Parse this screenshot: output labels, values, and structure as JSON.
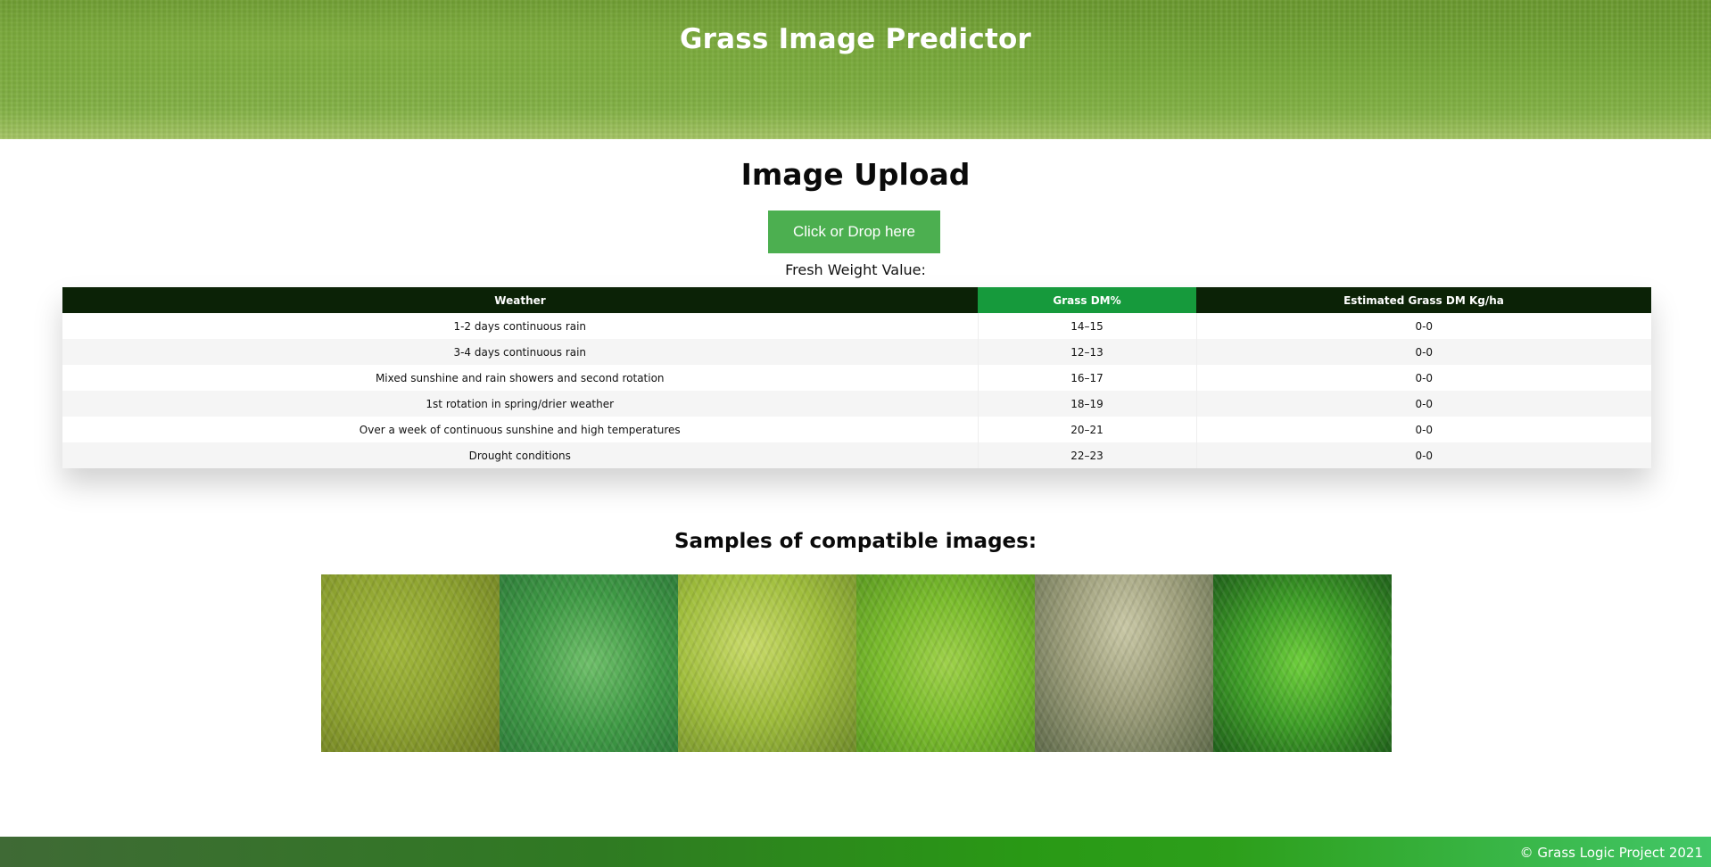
{
  "header": {
    "title": "Grass Image Predictor"
  },
  "upload": {
    "title": "Image Upload",
    "button_label": "Click or Drop here",
    "fresh_weight_label": "Fresh Weight Value:"
  },
  "table": {
    "headers": [
      "Weather",
      "Grass DM%",
      "Estimated Grass DM Kg/ha"
    ],
    "rows": [
      [
        "1-2 days continuous rain",
        "14–15",
        "0-0"
      ],
      [
        "3-4 days continuous rain",
        "12–13",
        "0-0"
      ],
      [
        "Mixed sunshine and rain showers and second rotation",
        "16–17",
        "0-0"
      ],
      [
        "1st rotation in spring/drier weather",
        "18–19",
        "0-0"
      ],
      [
        "Over a week of continuous sunshine and high temperatures",
        "20–21",
        "0-0"
      ],
      [
        "Drought conditions",
        "22–23",
        "0-0"
      ]
    ],
    "header_color": "#0b2206",
    "highlight_header_color": "#169a3c"
  },
  "samples": {
    "title": "Samples of compatible images:"
  },
  "footer": {
    "text": "© Grass Logic Project 2021"
  },
  "colors": {
    "button": "#4caf50"
  }
}
